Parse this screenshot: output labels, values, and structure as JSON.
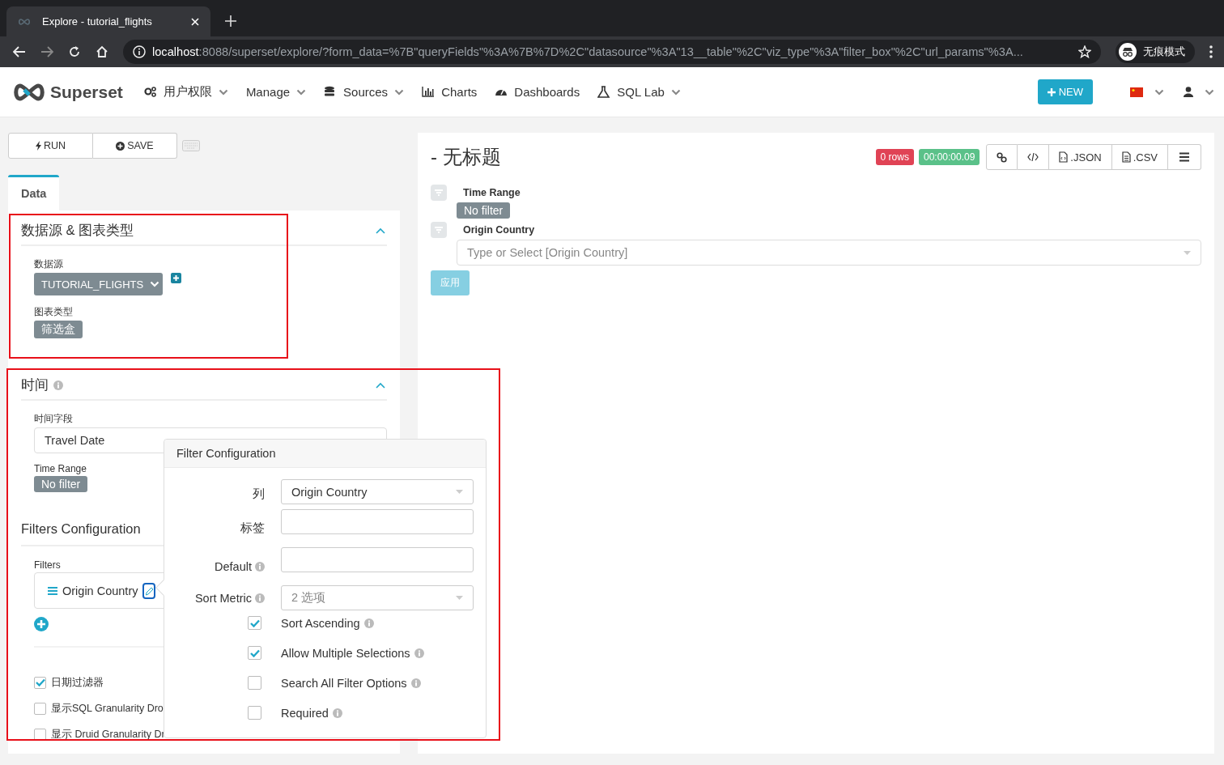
{
  "browser": {
    "tab_title": "Explore - tutorial_flights",
    "url_host": "localhost",
    "url_rest": ":8088/superset/explore/?form_data=%7B\"queryFields\"%3A%7B%7D%2C\"datasource\"%3A\"13__table\"%2C\"viz_type\"%3A\"filter_box\"%2C\"url_params\"%3A...",
    "profile_label": "无痕模式"
  },
  "navbar": {
    "brand": "Superset",
    "menu": [
      {
        "label": "用户权限",
        "kind": "gears",
        "dropdown": true
      },
      {
        "label": "Manage",
        "kind": "none",
        "dropdown": true
      },
      {
        "label": "Sources",
        "kind": "database",
        "dropdown": true
      },
      {
        "label": "Charts",
        "kind": "chart",
        "dropdown": false
      },
      {
        "label": "Dashboards",
        "kind": "gauge",
        "dropdown": false
      },
      {
        "label": "SQL Lab",
        "kind": "flask",
        "dropdown": true
      }
    ],
    "new_button": "NEW"
  },
  "explore": {
    "buttons": [
      {
        "label": "RUN",
        "kind": "bolt"
      },
      {
        "label": "SAVE",
        "kind": "plus"
      }
    ],
    "tabs": [
      {
        "label": "Data",
        "selected": true
      }
    ],
    "sections": [
      {
        "title": "数据源 & 图表类型",
        "info": false,
        "expanded": true,
        "highlighted": true,
        "controls": [
          {
            "kind": "datasource",
            "label": "数据源",
            "value": "TUTORIAL_FLIGHTS"
          },
          {
            "kind": "tag",
            "label": "图表类型",
            "value": "筛选盒"
          }
        ]
      },
      {
        "title": "时间",
        "info": true,
        "expanded": true,
        "highlighted": true,
        "controls": [
          {
            "kind": "select",
            "label": "时间字段",
            "value": "Travel Date"
          },
          {
            "kind": "tag",
            "label": "Time Range",
            "value": "No filter"
          },
          {
            "kind": "heading",
            "label": "Filters Configuration"
          },
          {
            "kind": "filters",
            "label": "Filters",
            "items": [
              "Origin Country"
            ]
          },
          {
            "kind": "checkbox",
            "label": "日期过滤器",
            "checked": true
          },
          {
            "kind": "checkbox",
            "label": "显示SQL Granularity Dro",
            "checked": false
          },
          {
            "kind": "checkbox",
            "label": "显示 Druid Granularity Dr",
            "checked": false
          }
        ]
      }
    ]
  },
  "popover": {
    "title": "Filter Configuration",
    "fields": [
      {
        "kind": "select",
        "label": "列",
        "info": false,
        "value": "Origin Country"
      },
      {
        "kind": "input",
        "label": "标签",
        "info": false
      },
      {
        "kind": "input",
        "label": "Default",
        "info": true
      },
      {
        "kind": "select",
        "label": "Sort Metric",
        "info": true,
        "placeholder": "2 选项"
      }
    ],
    "options": [
      {
        "label": "Sort Ascending",
        "checked": true
      },
      {
        "label": "Allow Multiple Selections",
        "checked": true
      },
      {
        "label": "Search All Filter Options",
        "checked": false
      },
      {
        "label": "Required",
        "checked": false
      }
    ]
  },
  "chart": {
    "title": "- 无标题",
    "row_count": "0 rows",
    "duration": "00:00:00.09",
    "actions": [
      {
        "kind": "link"
      },
      {
        "kind": "code"
      },
      {
        "kind": "file",
        "label": ".JSON"
      },
      {
        "kind": "doc",
        "label": ".CSV"
      },
      {
        "kind": "menu"
      }
    ],
    "filters": [
      {
        "kind": "tag",
        "label": "Time Range",
        "value": "No filter"
      },
      {
        "kind": "select",
        "label": "Origin Country",
        "placeholder": "Type or Select [Origin Country]"
      }
    ],
    "apply_button": {
      "label": "应用",
      "disabled": true
    }
  }
}
